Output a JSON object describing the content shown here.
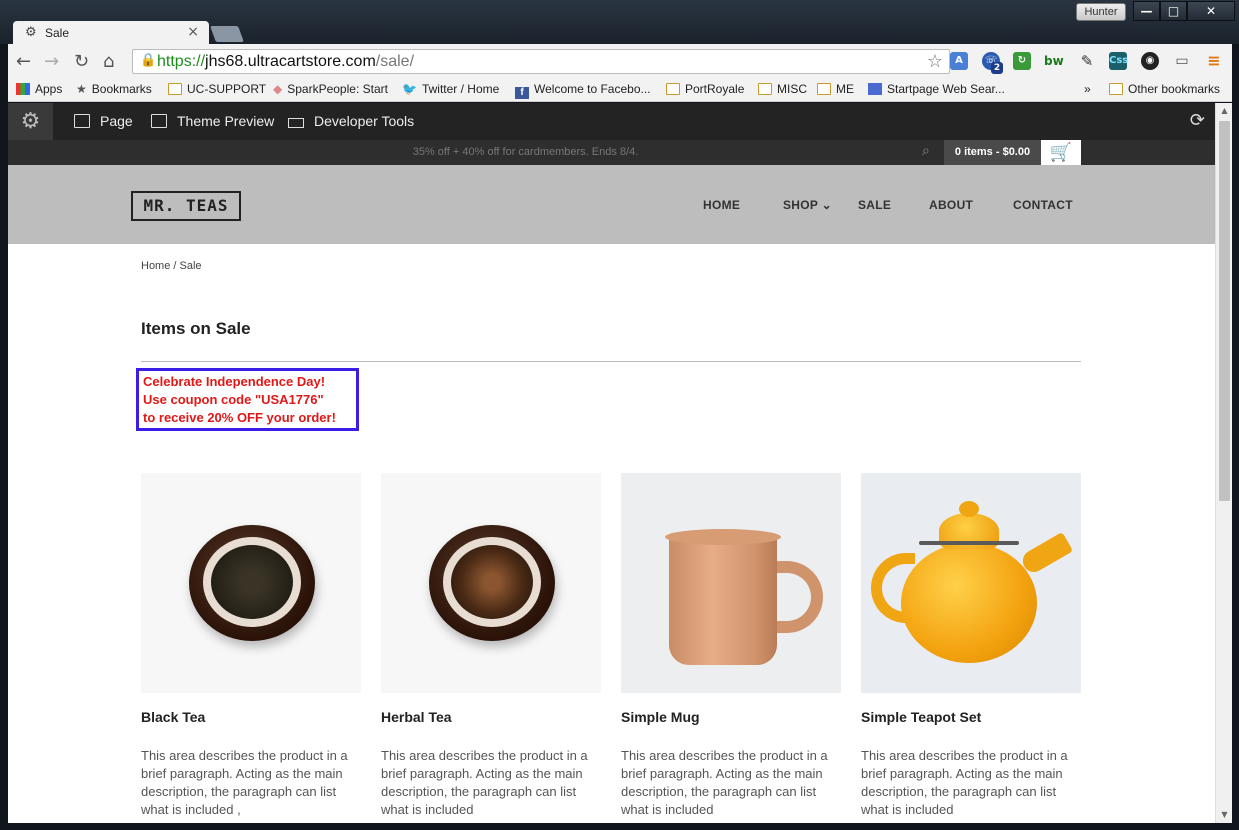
{
  "browser": {
    "tab_title": "Sale",
    "tab_close": "×",
    "user": "Hunter",
    "url_scheme": "https://",
    "url_host": "jhs68.ultracartstore.com",
    "url_path": "/sale/",
    "window_min": "—",
    "window_max": "□",
    "window_close": "✕",
    "bookmarks": [
      {
        "label": "Apps",
        "icon": "apps-grid-icon"
      },
      {
        "label": "Bookmarks",
        "icon": "star-icon"
      },
      {
        "label": "UC-SUPPORT",
        "icon": "folder-icon"
      },
      {
        "label": "SparkPeople: Start",
        "icon": "sparkpeople-icon"
      },
      {
        "label": "Twitter / Home",
        "icon": "twitter-icon"
      },
      {
        "label": "Welcome to Facebo...",
        "icon": "facebook-icon"
      },
      {
        "label": "PortRoyale",
        "icon": "folder-icon"
      },
      {
        "label": "MISC",
        "icon": "folder-icon"
      },
      {
        "label": "ME",
        "icon": "folder-icon"
      },
      {
        "label": "Startpage Web Sear...",
        "icon": "startpage-icon"
      }
    ],
    "bookmarks_overflow": "»",
    "other_bookmarks": "Other bookmarks",
    "extensions_badge": "2"
  },
  "cms_toolbar": {
    "items": [
      {
        "label": "Page",
        "icon": "page-icon"
      },
      {
        "label": "Theme Preview",
        "icon": "theme-preview-icon"
      },
      {
        "label": "Developer Tools",
        "icon": "developer-tools-icon"
      }
    ]
  },
  "promo": {
    "text": "35% off + 40% off for cardmembers. Ends 8/4.",
    "cart_summary": "0 items - $0.00"
  },
  "site": {
    "logo": "MR. TEAS",
    "nav": [
      "HOME",
      "SHOP",
      "SALE",
      "ABOUT",
      "CONTACT"
    ],
    "nav_shop_caret": "⌄"
  },
  "page": {
    "breadcrumb": "Home / Sale",
    "title": "Items on Sale",
    "coupon_lines": [
      "Celebrate Independence Day!",
      "Use coupon code \"USA1776\"",
      "to receive 20% OFF your order!"
    ]
  },
  "products": [
    {
      "name": "Black Tea",
      "desc": "This area describes the product in a brief paragraph. Acting as the main description, the paragraph can list what is included ,"
    },
    {
      "name": "Herbal Tea",
      "desc": "This area describes the product in a brief paragraph. Acting as the main description, the paragraph can list what is included"
    },
    {
      "name": "Simple Mug",
      "desc": "This area describes the product in a brief paragraph. Acting as the main description, the paragraph can list what is included"
    },
    {
      "name": "Simple Teapot Set",
      "desc": "This area describes the product in a brief paragraph. Acting as the main description, the paragraph can list what is included"
    }
  ],
  "colors": {
    "coupon_text": "#e01818",
    "coupon_border": "#3a1ee6",
    "header_bg": "#bdbdbd",
    "cms_bar": "#232323",
    "url_green": "#1f8c1f"
  }
}
